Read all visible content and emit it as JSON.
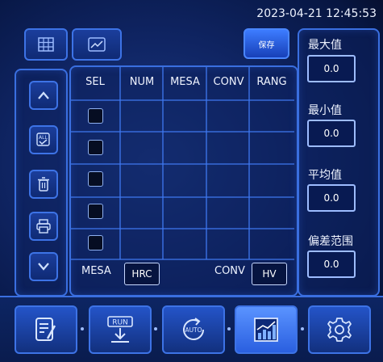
{
  "header": {
    "datetime": "2023-04-21 12:45:53"
  },
  "toolbar": {
    "save_label": "保存"
  },
  "table": {
    "columns": [
      "SEL",
      "NUM",
      "MESA",
      "CONV",
      "RANG"
    ],
    "rows": [
      {
        "selected": false
      },
      {
        "selected": false
      },
      {
        "selected": false
      },
      {
        "selected": false
      },
      {
        "selected": false
      }
    ]
  },
  "footer_row": {
    "mesa_label": "MESA",
    "mesa_value": "HRC",
    "conv_label": "CONV",
    "conv_value": "HV"
  },
  "stats": {
    "max_label": "最大值",
    "max_value": "0.0",
    "min_label": "最小值",
    "min_value": "0.0",
    "avg_label": "平均值",
    "avg_value": "0.0",
    "dev_label": "偏差范围",
    "dev_value": "0.0"
  },
  "side_icons": [
    "up-arrow-icon",
    "select-all-icon",
    "trash-icon",
    "printer-icon",
    "down-arrow-icon"
  ],
  "dock": {
    "run_label": "RUN",
    "auto_label": "AUTO"
  },
  "colors": {
    "accent": "#3a6fe0",
    "background": "#0f2462",
    "highlight": "#3d7cff"
  }
}
